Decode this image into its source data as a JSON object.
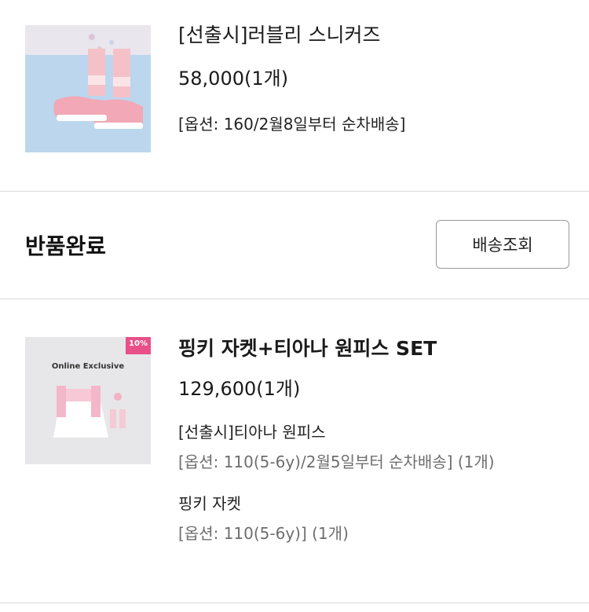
{
  "order_item_1": {
    "title": "[선출시]러블리 스니커즈",
    "price": "58,000(1개)",
    "option": "[옵션: 160/2월8일부터 순차배송]"
  },
  "status_section": {
    "label": "반품완료",
    "button_label": "배송조회"
  },
  "order_item_2": {
    "title": "핑키 자켓+티아나 원피스 SET",
    "price": "129,600(1개)",
    "thumbnail": {
      "badge": "10%",
      "caption": "Online Exclusive"
    },
    "components": [
      {
        "name": "[선출시]티아나 원피스",
        "option": "[옵션: 110(5-6y)/2월5일부터 순차배송] (1개)"
      },
      {
        "name": "핑키 자켓",
        "option": "[옵션: 110(5-6y)] (1개)"
      }
    ]
  }
}
